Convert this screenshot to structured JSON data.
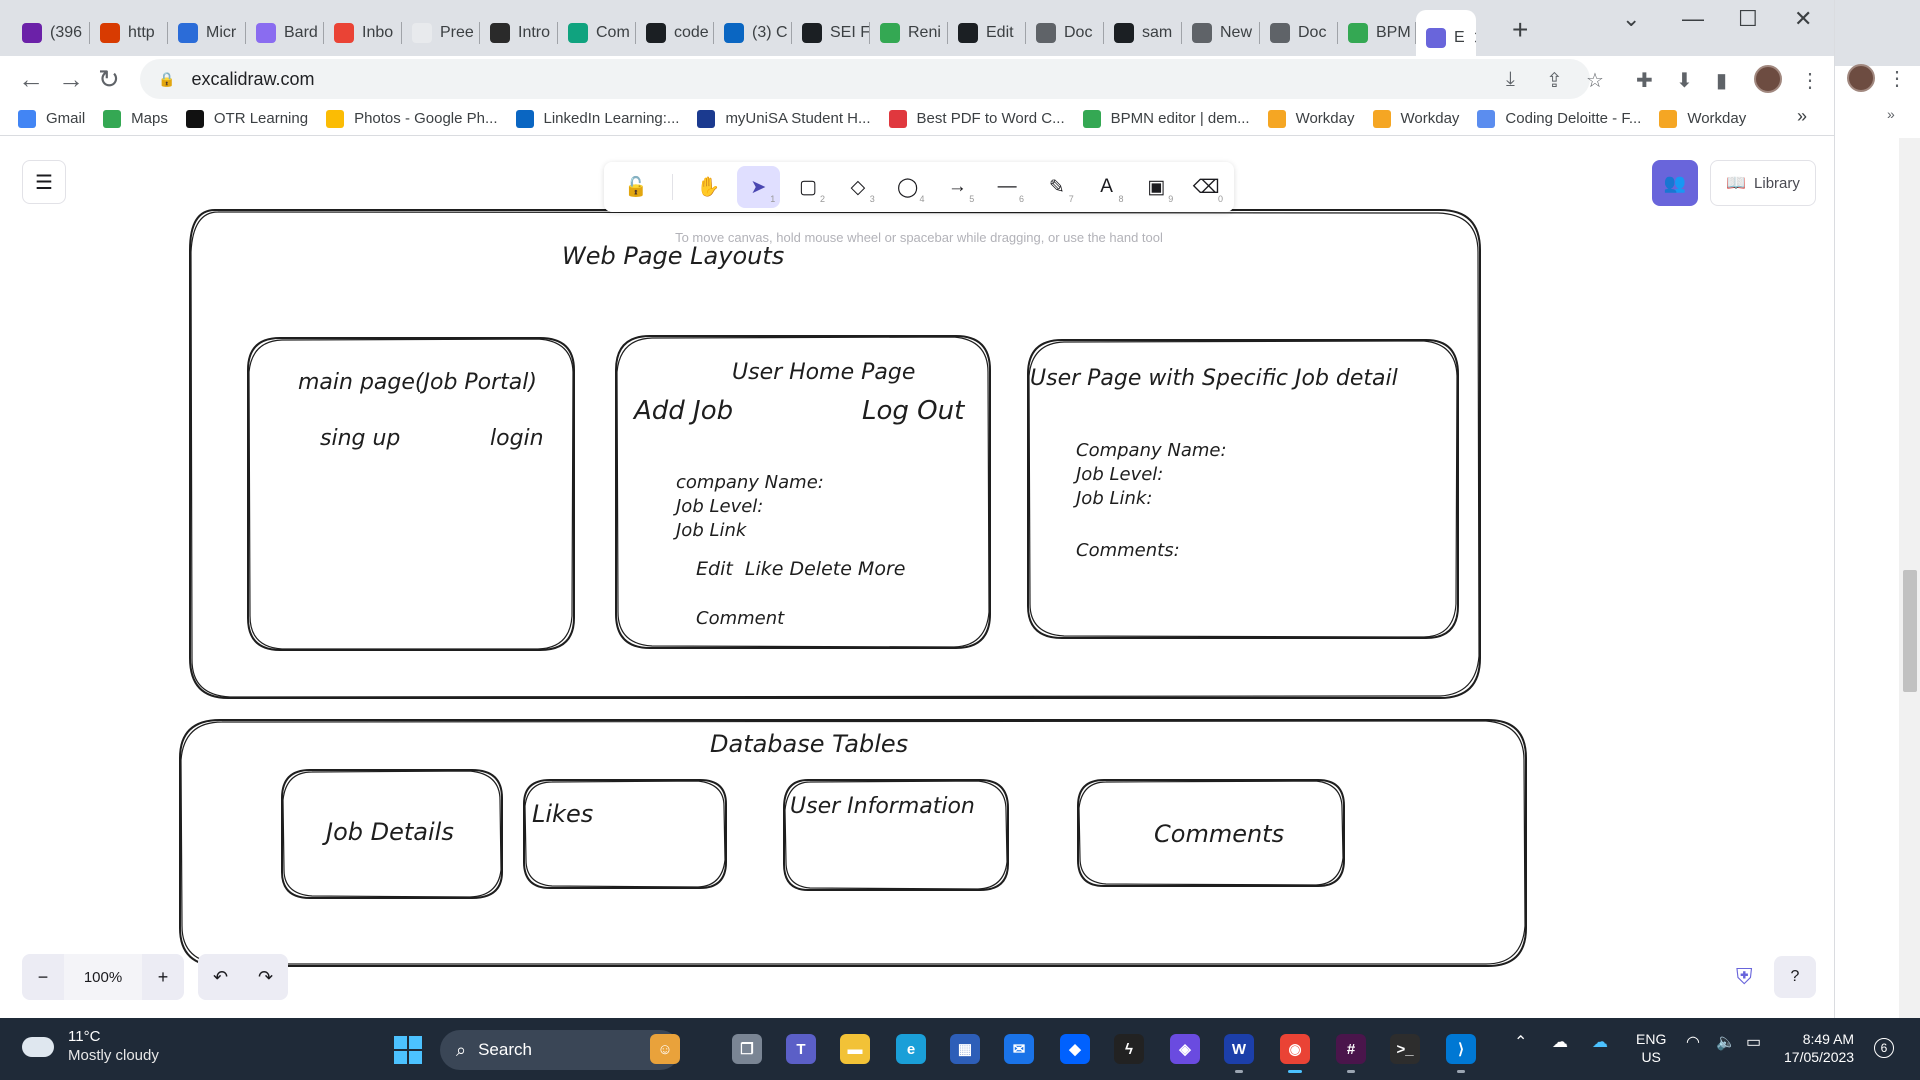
{
  "browser": {
    "tabs": [
      {
        "label": "(396",
        "icon": "mail-icon",
        "color": "#6b21a8"
      },
      {
        "label": "http",
        "icon": "office-icon",
        "color": "#d83b01"
      },
      {
        "label": "Micr",
        "icon": "copilot-icon",
        "color": "#2b6cd8"
      },
      {
        "label": "Bard",
        "icon": "bard-icon",
        "color": "#8a6cf0"
      },
      {
        "label": "Inbo",
        "icon": "gmail-icon",
        "color": "#ea4335"
      },
      {
        "label": "Pree",
        "icon": "blank-page-icon",
        "color": "#e8eaed"
      },
      {
        "label": "Intro",
        "icon": "openai-icon",
        "color": "#2a2a2a"
      },
      {
        "label": "Com",
        "icon": "openai-icon",
        "color": "#10a37f"
      },
      {
        "label": "code",
        "icon": "github-icon",
        "color": "#1b1f23"
      },
      {
        "label": "(3) C",
        "icon": "linkedin-icon",
        "color": "#0a66c2"
      },
      {
        "label": "SEI F",
        "icon": "github-icon",
        "color": "#1b1f23"
      },
      {
        "label": "Reni",
        "icon": "renew-icon",
        "color": "#34a853"
      },
      {
        "label": "Edit",
        "icon": "github-icon",
        "color": "#1b1f23"
      },
      {
        "label": "Doc",
        "icon": "globe-icon",
        "color": "#5f6368"
      },
      {
        "label": "sam",
        "icon": "github-icon",
        "color": "#1b1f23"
      },
      {
        "label": "New",
        "icon": "chrome-icon",
        "color": "#5f6368"
      },
      {
        "label": "Doc",
        "icon": "globe-icon",
        "color": "#5f6368"
      },
      {
        "label": "BPM",
        "icon": "bpmn-icon",
        "color": "#34a853"
      },
      {
        "label": "E",
        "icon": "excalidraw-icon",
        "color": "#6965db"
      }
    ],
    "new_tab": "+",
    "url": "excalidraw.com",
    "bookmarks": [
      {
        "label": "Gmail",
        "icon": "google-icon",
        "color": "#4285f4"
      },
      {
        "label": "Maps",
        "icon": "maps-icon",
        "color": "#34a853"
      },
      {
        "label": "OTR Learning",
        "icon": "otr-icon",
        "color": "#111111"
      },
      {
        "label": "Photos - Google Ph...",
        "icon": "photos-icon",
        "color": "#fbbc04"
      },
      {
        "label": "LinkedIn Learning:...",
        "icon": "linkedin-icon",
        "color": "#0a66c2"
      },
      {
        "label": "myUniSA Student H...",
        "icon": "unisa-icon",
        "color": "#1b3a8f"
      },
      {
        "label": "Best PDF to Word C...",
        "icon": "pdf-icon",
        "color": "#e0383e"
      },
      {
        "label": "BPMN editor | dem...",
        "icon": "bpmn-icon",
        "color": "#34a853"
      },
      {
        "label": "Workday",
        "icon": "workday-icon",
        "color": "#f5a623"
      },
      {
        "label": "Workday",
        "icon": "workday-icon",
        "color": "#f5a623"
      },
      {
        "label": "Coding Deloitte - F...",
        "icon": "deloitte-icon",
        "color": "#5b8def"
      },
      {
        "label": "Workday",
        "icon": "workday-icon",
        "color": "#f5a623"
      }
    ],
    "bookmarks_more": "»"
  },
  "excalidraw": {
    "hint": "To move canvas, hold mouse wheel or spacebar while dragging, or use the hand tool",
    "tools": [
      {
        "name": "lock-icon",
        "glyph": "🔓",
        "key": ""
      },
      {
        "name": "hand-icon",
        "glyph": "✋",
        "key": ""
      },
      {
        "name": "selection-icon",
        "glyph": "➤",
        "key": "1"
      },
      {
        "name": "rectangle-icon",
        "glyph": "▢",
        "key": "2"
      },
      {
        "name": "diamond-icon",
        "glyph": "◇",
        "key": "3"
      },
      {
        "name": "ellipse-icon",
        "glyph": "◯",
        "key": "4"
      },
      {
        "name": "arrow-icon",
        "glyph": "→",
        "key": "5"
      },
      {
        "name": "line-icon",
        "glyph": "—",
        "key": "6"
      },
      {
        "name": "pencil-icon",
        "glyph": "✎",
        "key": "7"
      },
      {
        "name": "text-icon",
        "glyph": "A",
        "key": "8"
      },
      {
        "name": "image-icon",
        "glyph": "▣",
        "key": "9"
      },
      {
        "name": "eraser-icon",
        "glyph": "⌫",
        "key": "0"
      }
    ],
    "active_tool": "selection-icon",
    "library_label": "Library",
    "zoom": "100%",
    "accent": "#6965db"
  },
  "drawing": {
    "web_title": "Web Page Layouts",
    "main_page": {
      "title": "main page(Job Portal)",
      "signup": "sing up",
      "login": "login"
    },
    "user_home": {
      "title": "User Home Page",
      "add_job": "Add Job",
      "log_out": "Log Out",
      "company": "company Name:",
      "level": "Job Level:",
      "link": "Job Link",
      "actions": "Edit  Like Delete More",
      "comment": "Comment"
    },
    "job_detail": {
      "title": "User Page with Specific Job detail",
      "company": "Company Name:",
      "level": "Job Level:",
      "link": "Job Link:",
      "comments": "Comments:"
    },
    "db_title": "Database Tables",
    "tables": {
      "job_details": "Job Details",
      "likes": "Likes",
      "user_info": "User Information",
      "comments": "Comments"
    }
  },
  "taskbar": {
    "temperature": "11°C",
    "weather": "Mostly cloudy",
    "search": "Search",
    "lang_top": "ENG",
    "lang_bottom": "US",
    "time": "8:49 AM",
    "date": "17/05/2023",
    "notifications": "6"
  }
}
